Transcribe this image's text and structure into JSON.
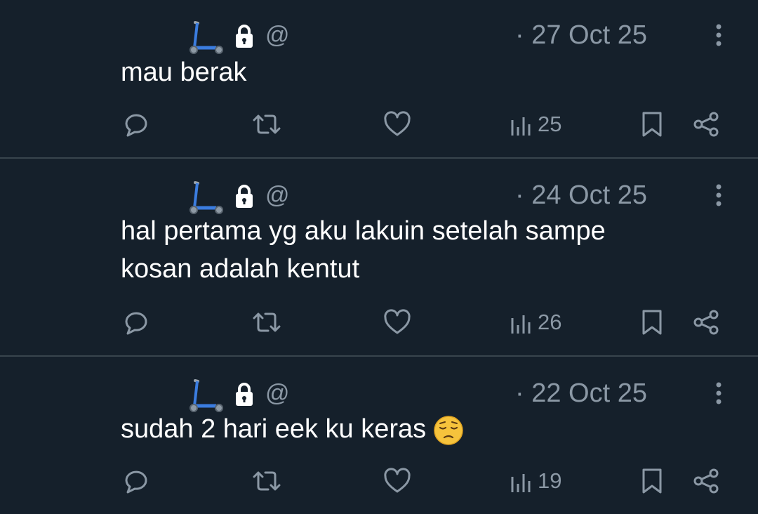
{
  "tweets": [
    {
      "handle": "@",
      "date": "· 27 Oct 25",
      "lines": [
        "mau berak"
      ],
      "views": "25"
    },
    {
      "handle": "@",
      "date": "· 24 Oct 25",
      "lines": [
        "hal pertama yg aku lakuin setelah sampe",
        "kosan adalah kentut"
      ],
      "views": "26"
    },
    {
      "handle": "@",
      "date": "· 22 Oct 25",
      "lines": [
        "sudah 2 hari eek ku keras"
      ],
      "emoji": "pensive-face",
      "views": "19"
    }
  ],
  "icons": {
    "avatar_badge": "kick-scooter-icon",
    "protected": "lock-icon",
    "more": "more-vertical-icon",
    "reply": "reply-icon",
    "retweet": "retweet-icon",
    "like": "heart-icon",
    "views": "views-icon",
    "bookmark": "bookmark-icon",
    "share": "share-icon"
  },
  "colors": {
    "background": "#15202b",
    "muted": "#8b98a5",
    "divider": "#38444d",
    "text": "#ffffff",
    "scooter": "#2f6fd6"
  }
}
